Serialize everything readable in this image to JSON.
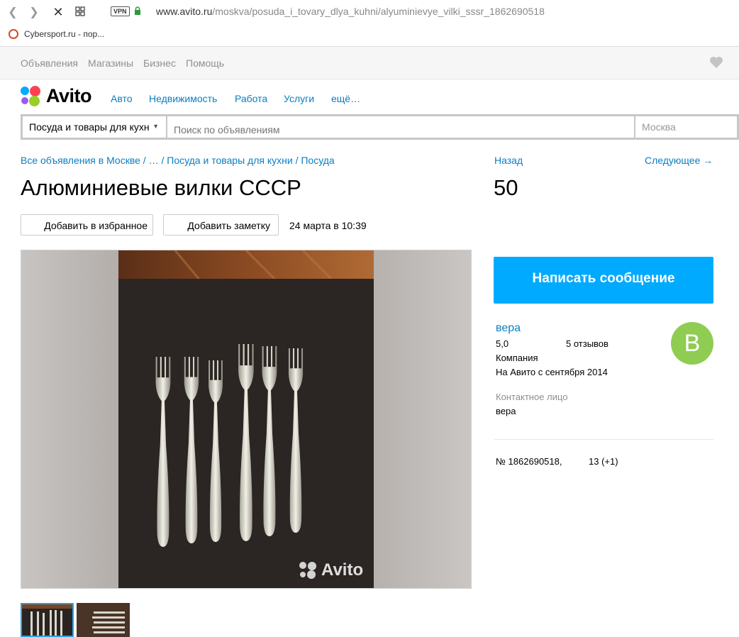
{
  "browser": {
    "url_host": "www.avito.ru",
    "url_path": "/moskva/posuda_i_tovary_dlya_kuhni/alyuminievye_vilki_sssr_1862690518",
    "vpn_label": "VPN",
    "bookmark": "Cybersport.ru - пор..."
  },
  "topnav": {
    "items": [
      "Объявления",
      "Магазины",
      "Бизнес",
      "Помощь"
    ]
  },
  "logo": {
    "text": "Avito"
  },
  "categories": [
    "Авто",
    "Недвижимость",
    "Работа",
    "Услуги",
    "ещё…"
  ],
  "search": {
    "category": "Посуда и товары для кухн",
    "placeholder": "Поиск по объявлениям",
    "city": "Москва"
  },
  "breadcrumbs": {
    "all": "Все объявления в Москве",
    "ellipsis": "…",
    "category": "Посуда и товары для кухни",
    "subcategory": "Посуда"
  },
  "pager": {
    "back": "Назад",
    "next": "Следующее →"
  },
  "listing": {
    "title": "Алюминиевые вилки СССР",
    "price": "50",
    "add_favorite": "Добавить в избранное",
    "add_note": "Добавить заметку",
    "date": "24 марта в 10:39",
    "watermark": "Avito"
  },
  "seller": {
    "write_button": "Написать сообщение",
    "name": "вера",
    "rating": "5,0",
    "reviews": "5 отзывов",
    "type": "Компания",
    "since": "На Авито с сентября 2014",
    "avatar_letter": "В",
    "contact_label": "Контактное лицо",
    "contact_name": "вера"
  },
  "stats": {
    "ad_number": "№ 1862690518,",
    "views": "13 (+1)"
  },
  "colors": {
    "link": "#0a7ec2",
    "primary_button": "#00aaff",
    "avatar": "#8fcc52"
  }
}
